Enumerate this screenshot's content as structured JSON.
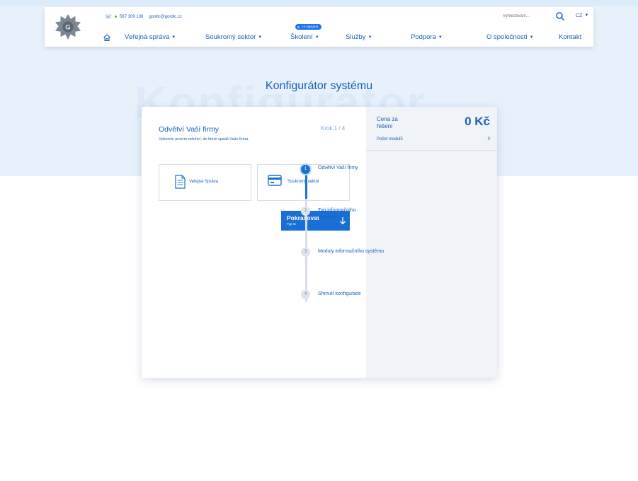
{
  "header": {
    "contact_phone": "567 309 136",
    "contact_email": "gordic@gordic.cz",
    "search_placeholder": "Vyhledávání...",
    "language": "CZ",
    "badge": "+3 vypsané",
    "nav": [
      {
        "label": "Veřejná správa",
        "has_dropdown": true
      },
      {
        "label": "Soukromý sektor",
        "has_dropdown": true
      },
      {
        "label": "Školení",
        "has_dropdown": true
      },
      {
        "label": "Služby",
        "has_dropdown": true
      },
      {
        "label": "Podpora",
        "has_dropdown": true
      },
      {
        "label": "O společnosti",
        "has_dropdown": true
      },
      {
        "label": "Kontakt",
        "has_dropdown": false
      }
    ]
  },
  "page": {
    "title": "Konfigurátor systému",
    "watermark": "Konfigurátor"
  },
  "configurator": {
    "heading": "Odvětví Vaší firmy",
    "subtitle": "Vyberete prosím odvětví,  do které spadá Vaše firma.",
    "step_counter": "Krok 1 / 4",
    "options": [
      {
        "label": "Veřejná Správa",
        "icon": "document-icon"
      },
      {
        "label": "Soukromý sektor",
        "icon": "card-icon"
      }
    ],
    "continue_button": {
      "label": "Pokračovat",
      "sublabel": "Typ IS"
    }
  },
  "summary": {
    "price_label": "Cena za řešení",
    "price_value": "0 Kč",
    "modules_label": "Počet modulů",
    "modules_value": "0",
    "steps": [
      {
        "number": "1",
        "label": "Odvětví Vaší firmy",
        "active": true
      },
      {
        "number": "2",
        "label": "Typ informačního systému",
        "active": false
      },
      {
        "number": "3",
        "label": "Moduly informačního systému",
        "active": false
      },
      {
        "number": "4",
        "label": "Shrnutí konfigurace",
        "active": false
      }
    ]
  },
  "colors": {
    "brand_blue": "#1a5fb4",
    "button_blue": "#1a6fd6",
    "hero_bg": "#e6f1fc",
    "panel_bg": "#f0f3f7"
  }
}
